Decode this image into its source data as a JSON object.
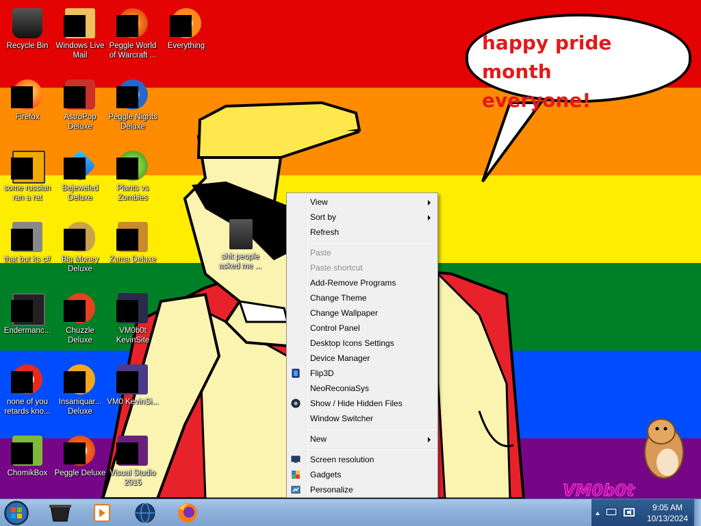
{
  "wallpaper": {
    "speech_line1": "happy pride month",
    "speech_line2": "everyone!",
    "signature": "VM0b0t"
  },
  "desktop_icons": [
    {
      "label": "Recycle Bin",
      "icon": "recycle-bin-icon"
    },
    {
      "label": "Windows Live Mail",
      "icon": "windows-live-mail-icon"
    },
    {
      "label": "Peggle World of Warcraft ...",
      "icon": "peggle-wow-icon"
    },
    {
      "label": "Everything",
      "icon": "everything-icon"
    },
    {
      "label": "Firefox",
      "icon": "firefox-icon"
    },
    {
      "label": "AstroPop Deluxe",
      "icon": "astropop-icon"
    },
    {
      "label": "Peggle Nights Deluxe",
      "icon": "peggle-nights-icon"
    },
    {
      "label": "some russian ran a rat",
      "icon": "rat-game-icon"
    },
    {
      "label": "Bejeweled Deluxe",
      "icon": "bejeweled-icon"
    },
    {
      "label": "Plants vs Zombies",
      "icon": "plants-vs-zombies-icon"
    },
    {
      "label": "that but its c#",
      "icon": "program-icon"
    },
    {
      "label": "Big Money Deluxe",
      "icon": "big-money-icon"
    },
    {
      "label": "Zuma Deluxe",
      "icon": "zuma-icon"
    },
    {
      "label": "Endermanc...",
      "icon": "endermanc-icon"
    },
    {
      "label": "Chuzzle Deluxe",
      "icon": "chuzzle-icon"
    },
    {
      "label": "VM0b0t KevinSite",
      "icon": "kevinsite-icon"
    },
    {
      "label": "none of you retards kno...",
      "icon": "program-icon"
    },
    {
      "label": "Insaniquar... Deluxe",
      "icon": "insaniquarium-icon"
    },
    {
      "label": "VM0 KevinSi...",
      "icon": "kevinsite-icon"
    },
    {
      "label": "ChomikBox",
      "icon": "chomikbox-icon"
    },
    {
      "label": "Peggle Deluxe",
      "icon": "peggle-icon"
    },
    {
      "label": "Visual Studio 2015",
      "icon": "visual-studio-icon"
    },
    {
      "label": "shit people asked me ...",
      "icon": "folder-icon"
    }
  ],
  "context_menu": {
    "view": "View",
    "sort_by": "Sort by",
    "refresh": "Refresh",
    "paste": "Paste",
    "paste_shortcut": "Paste shortcut",
    "add_remove_programs": "Add-Remove Programs",
    "change_theme": "Change Theme",
    "change_wallpaper": "Change Wallpaper",
    "control_panel": "Control Panel",
    "desktop_icons_settings": "Desktop Icons Settings",
    "device_manager": "Device Manager",
    "flip3d": "Flip3D",
    "neoreconiasys": "NeoReconiaSys",
    "show_hide_hidden_files": "Show / Hide Hidden Files",
    "window_switcher": "Window Switcher",
    "new": "New",
    "screen_resolution": "Screen resolution",
    "gadgets": "Gadgets",
    "personalize": "Personalize"
  },
  "taskbar": {
    "time": "9:05 AM",
    "date": "10/13/2024"
  }
}
